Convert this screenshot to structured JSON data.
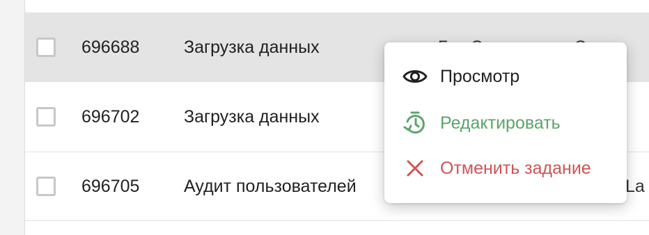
{
  "table": {
    "rows": [
      {
        "id": "696688",
        "name": "Загрузка данных",
        "extra": "...Гео Сенинге....к. С"
      },
      {
        "id": "696702",
        "name": "Загрузка данных",
        "extra": ""
      },
      {
        "id": "696705",
        "name": "Аудит пользователей",
        "extra": "La"
      }
    ]
  },
  "context_menu": {
    "items": [
      {
        "label": "Просмотр",
        "icon": "eye-icon",
        "color": "#212121"
      },
      {
        "label": "Редактировать",
        "icon": "timer-refresh-icon",
        "color": "#5aa469"
      },
      {
        "label": "Отменить задание",
        "icon": "close-icon",
        "color": "#d05353"
      }
    ]
  }
}
